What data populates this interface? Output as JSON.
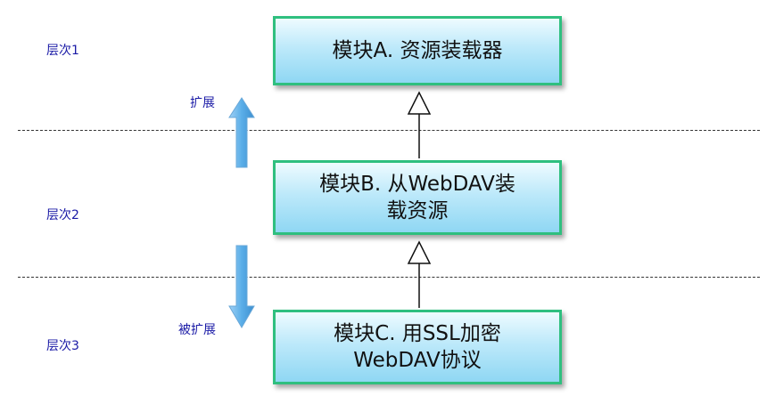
{
  "layers": {
    "layer1": "层次1",
    "layer2": "层次2",
    "layer3": "层次3"
  },
  "arrows": {
    "extend_label": "扩展",
    "extended_label": "被扩展"
  },
  "modules": {
    "a": {
      "line1": "模块A. 资源装载器"
    },
    "b": {
      "line1": "模块B. 从WebDAV装",
      "line2": "载资源"
    },
    "c": {
      "line1": "模块C. 用SSL加密",
      "line2": "WebDAV协议"
    }
  },
  "colors": {
    "box_border": "#2fbf7f",
    "box_fill_top": "#eefbff",
    "box_fill_bottom": "#8fd7f3",
    "label_text": "#1a1aa6",
    "arrow_fill": "#5aaee8"
  }
}
